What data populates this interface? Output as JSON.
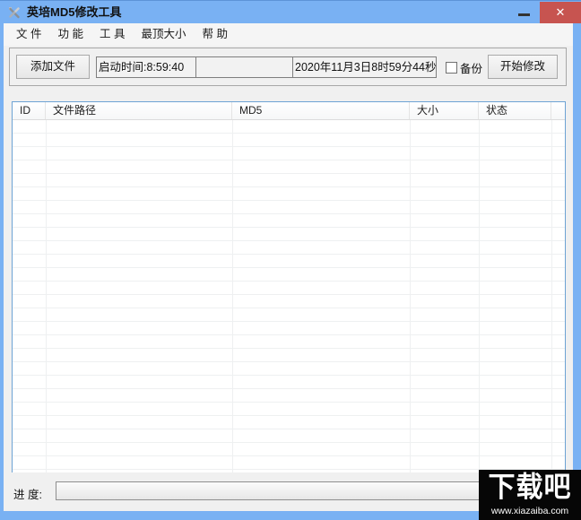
{
  "window": {
    "title": "英培MD5修改工具"
  },
  "icons": {
    "app_icon": "tools-icon (crossed wrench and screwdriver)",
    "minimize": "minimize-dash",
    "close_glyph": "✕"
  },
  "menu": {
    "items": [
      "文 件",
      "功 能",
      "工 具",
      "最顶大小",
      "帮 助"
    ]
  },
  "toolbar": {
    "add_file_button": "添加文件",
    "start_time": "启动时间:8:59:40",
    "middle_segment": "",
    "datetime": "2020年11月3日8时59分44秒",
    "backup_label": "备份",
    "backup_checked": false,
    "start_button": "开始修改"
  },
  "table": {
    "columns": [
      {
        "label": "ID"
      },
      {
        "label": "文件路径"
      },
      {
        "label": "MD5"
      },
      {
        "label": "大小"
      },
      {
        "label": "状态"
      }
    ],
    "rows": []
  },
  "progress": {
    "label": "进 度:",
    "value_percent": 0
  },
  "watermark": {
    "logo": "下载吧",
    "url": "www.xiazaiba.com"
  },
  "colors": {
    "titlebar_blue": "#79b1f3",
    "title_edge": "#5d93d8",
    "close_red": "#c75450",
    "client_gray": "#f0f0f0",
    "table_border_blue": "#6da3d4",
    "grid_line": "#eef0f1"
  }
}
